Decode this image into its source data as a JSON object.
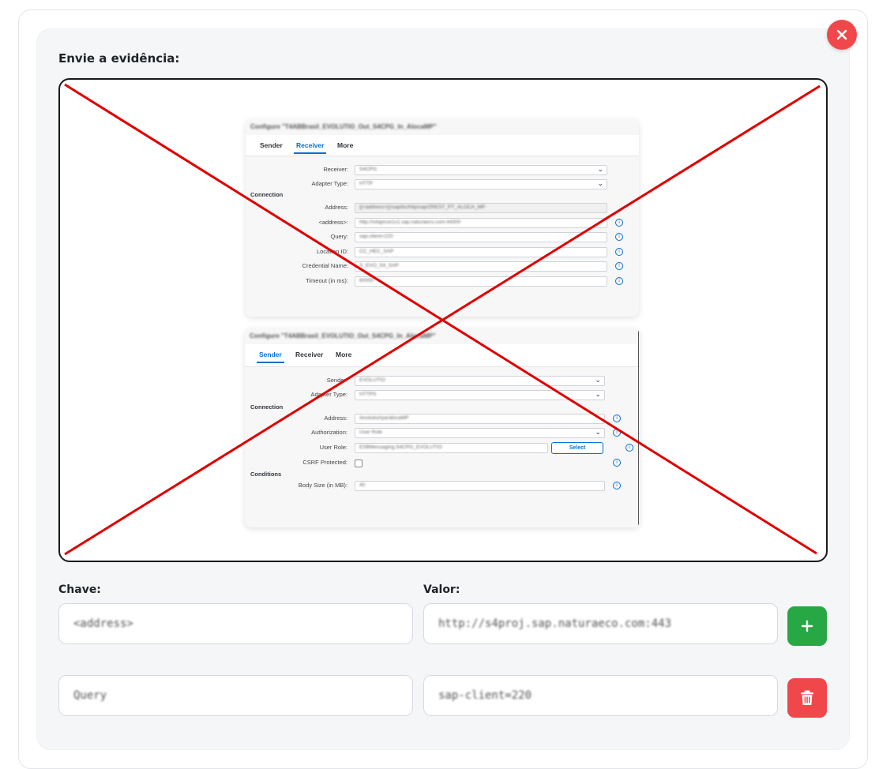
{
  "evidence_label": "Envie a evidência:",
  "colors": {
    "close": "#f0474b",
    "add": "#28a745",
    "delete": "#f0474b",
    "cross": "#e00000",
    "sap_active": "#0a6ed1"
  },
  "icons": {
    "close": "close-icon",
    "add": "plus-icon",
    "delete": "trash-icon",
    "info": "info-icon",
    "chevron": "chevron-down-icon"
  },
  "screenshot": {
    "receiver_panel": {
      "title": "Configure \"T4ABBrasil_EVOLUTIO_Out_S4CPG_In_AlocaMP\"",
      "tabs": [
        "Sender",
        "Receiver",
        "More"
      ],
      "active_tab": "Receiver",
      "section": "Connection",
      "rows": [
        {
          "label": "Receiver:",
          "value": "S4CPG",
          "type": "select"
        },
        {
          "label": "Adapter Type:",
          "value": "HTTP",
          "type": "select"
        },
        {
          "label": "Address:",
          "value": "{{<address>}}/sap/bc/http/sap/ZREST_PT_ALOCA_MP",
          "type": "disabled"
        },
        {
          "label": "<address>:",
          "value": "http://s4aproxi1v1.sap.naturaeco.com:44300",
          "type": "input"
        },
        {
          "label": "Query:",
          "value": "sap-client=220",
          "type": "input"
        },
        {
          "label": "Location ID:",
          "value": "CC_HEC_SAP",
          "type": "input"
        },
        {
          "label": "Credential Name:",
          "value": "S_EVO_S4_SAP",
          "type": "input"
        },
        {
          "label": "Timeout (in ms):",
          "value": "60000",
          "type": "input"
        }
      ]
    },
    "sender_panel": {
      "title": "Configure \"T4ABBrasil_EVOLUTIO_Out_S4CPG_In_AlocaMP\"",
      "tabs": [
        "Sender",
        "Receiver",
        "More"
      ],
      "active_tab": "Sender",
      "sections": [
        "Connection",
        "Conditions"
      ],
      "rows": [
        {
          "label": "Sender:",
          "value": "EVOLUTIO",
          "type": "select"
        },
        {
          "label": "Adapter Type:",
          "value": "HTTPS",
          "type": "select"
        },
        {
          "label": "Address:",
          "value": "/evolutio/rpa/alocaMP",
          "type": "input"
        },
        {
          "label": "Authorization:",
          "value": "User Role",
          "type": "select"
        },
        {
          "label": "User Role:",
          "value": "ESBMessaging.S4CPG_EVOLUTIO",
          "type": "input-button",
          "button": "Select"
        },
        {
          "label": "CSRF Protected:",
          "value": "",
          "type": "checkbox"
        },
        {
          "label": "Body Size (in MB):",
          "value": "40",
          "type": "input"
        }
      ]
    }
  },
  "form": {
    "key_label": "Chave:",
    "value_label": "Valor:",
    "rows": [
      {
        "key": "<address>",
        "value": "http://s4proj.sap.naturaeco.com:443"
      },
      {
        "key": "Query",
        "value": "sap-client=220"
      }
    ]
  }
}
